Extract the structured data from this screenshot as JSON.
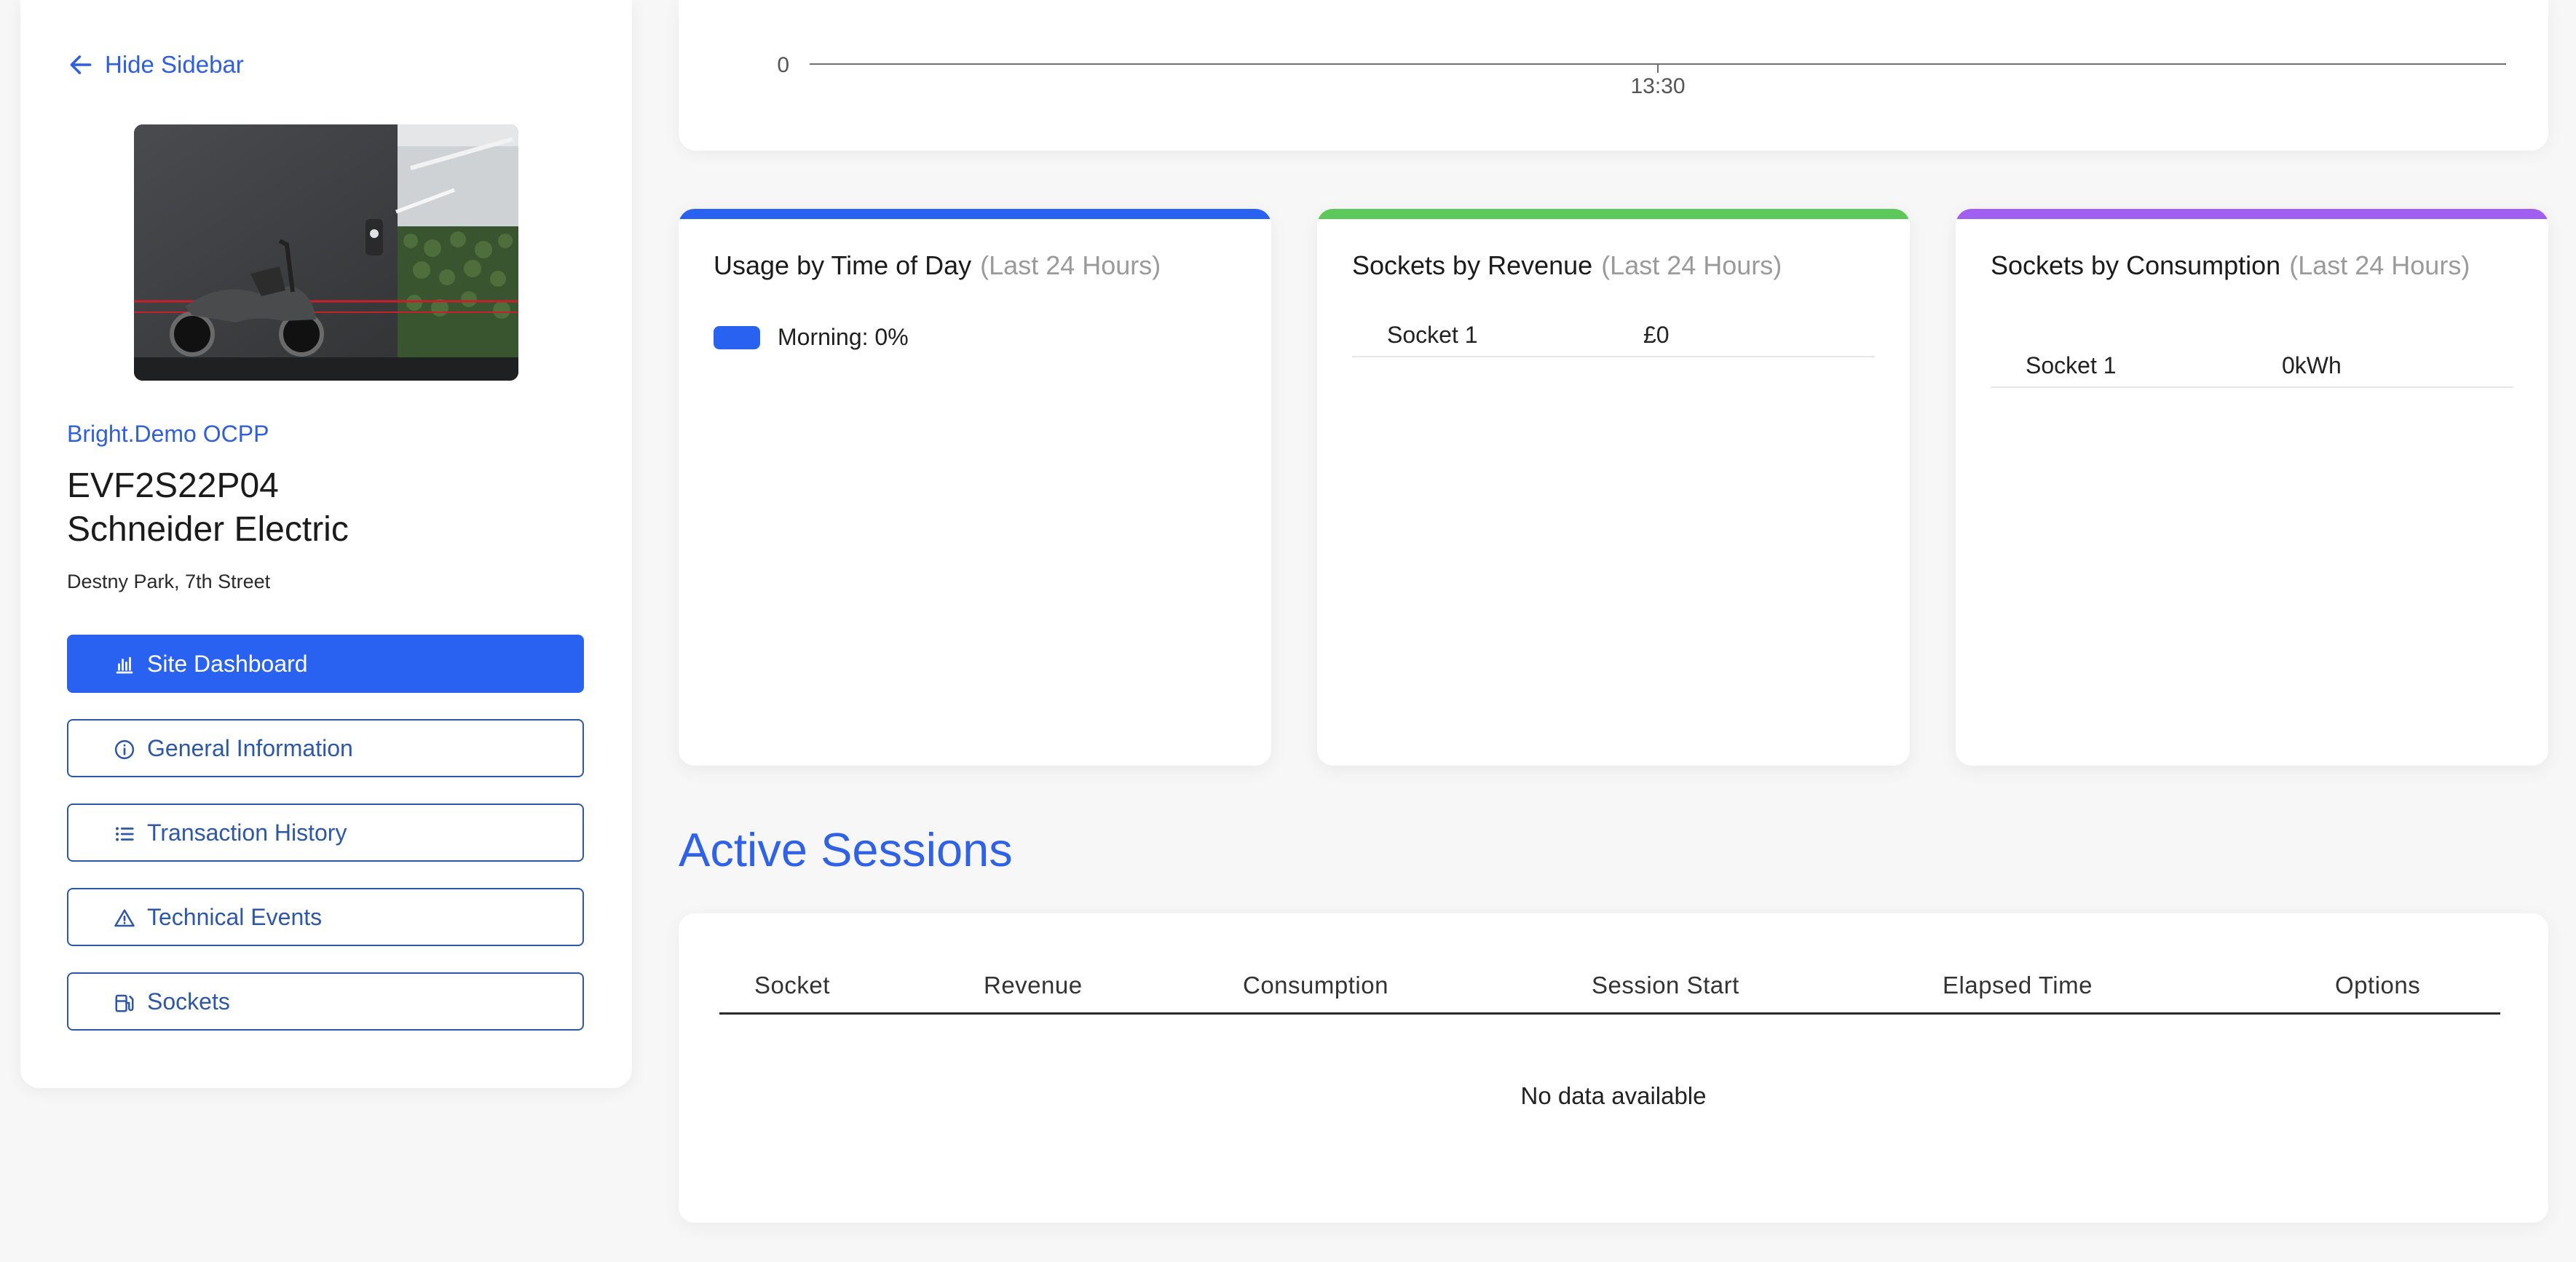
{
  "sidebar": {
    "hide_label": "Hide Sidebar",
    "operator": "Bright.Demo OCPP",
    "charger_id": "EVF2S22P04",
    "manufacturer": "Schneider Electric",
    "address": "Destny Park, 7th Street",
    "nav": [
      {
        "label": "Site Dashboard",
        "icon": "bar-chart-icon",
        "active": true
      },
      {
        "label": "General Information",
        "icon": "info-icon",
        "active": false
      },
      {
        "label": "Transaction History",
        "icon": "list-icon",
        "active": false
      },
      {
        "label": "Technical Events",
        "icon": "warning-icon",
        "active": false
      },
      {
        "label": "Sockets",
        "icon": "charger-icon",
        "active": false
      }
    ]
  },
  "chart_data": {
    "type": "line",
    "x": [
      "13:30"
    ],
    "series": [
      {
        "values": [
          0
        ]
      }
    ],
    "ytick_labels": [
      "0"
    ],
    "xtick_labels": [
      "13:30"
    ]
  },
  "cards": {
    "usage": {
      "title": "Usage by Time of Day",
      "subtitle": "(Last 24 Hours)",
      "legend_label": "Morning: 0%",
      "accent": "#2962f0"
    },
    "revenue": {
      "title": "Sockets by Revenue",
      "subtitle": "(Last 24 Hours)",
      "accent": "#5cc95a",
      "rows": [
        {
          "socket": "Socket 1",
          "value": "£0"
        }
      ]
    },
    "consumption": {
      "title": "Sockets by Consumption",
      "subtitle": "(Last 24 Hours)",
      "accent": "#a05ff0",
      "rows": [
        {
          "socket": "Socket 1",
          "value": "0kWh"
        }
      ]
    }
  },
  "sessions": {
    "title": "Active Sessions",
    "columns": [
      "Socket",
      "Revenue",
      "Consumption",
      "Session Start",
      "Elapsed Time",
      "Options"
    ],
    "empty_text": "No data available"
  }
}
